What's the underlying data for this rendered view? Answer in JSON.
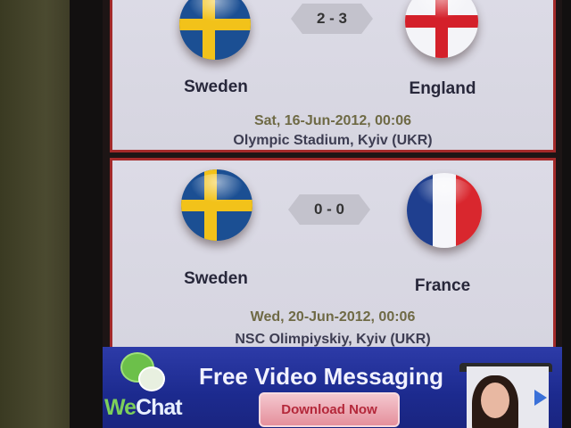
{
  "matches": [
    {
      "home_team": "Sweden",
      "away_team": "England",
      "score": "2 - 3",
      "date": "Sat, 16-Jun-2012, 00:06",
      "venue": "Olympic Stadium, Kyiv (UKR)",
      "home_flag_icon": "sweden-flag-icon",
      "away_flag_icon": "england-flag-icon"
    },
    {
      "home_team": "Sweden",
      "away_team": "France",
      "score": "0 - 0",
      "date": "Wed, 20-Jun-2012, 00:06",
      "venue": "NSC Olimpiyskiy, Kyiv (UKR)",
      "home_flag_icon": "sweden-flag-icon",
      "away_flag_icon": "france-flag-icon"
    }
  ],
  "ad": {
    "brand": "WeChat",
    "brand_prefix": "We",
    "brand_suffix": "Chat",
    "headline": "Free Video Messaging",
    "button_label": "Download Now"
  },
  "colors": {
    "card_border": "#a32a2a",
    "card_background": "#dcdbe6",
    "ad_background": "#1c2a8e",
    "ad_button": "#e5909c"
  }
}
